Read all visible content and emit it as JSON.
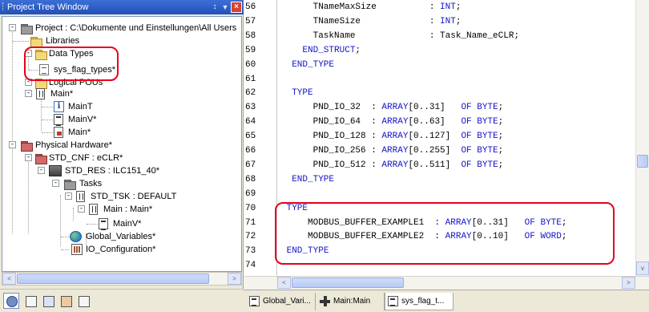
{
  "tree_window": {
    "title": "Project Tree Window",
    "pin_symbol": "↕",
    "menu_symbol": "▼",
    "close_symbol": "×",
    "nodes": {
      "project": "Project : C:\\Dokumente und Einstellungen\\All Users",
      "libraries": "Libraries",
      "data_types": "Data Types",
      "sys_flag_types": "sys_flag_types*",
      "logical_pous": "Logical POUs",
      "main": "Main*",
      "main_t": "MainT",
      "main_v": "MainV*",
      "main_code": "Main*",
      "physical_hardware": "Physical Hardware*",
      "std_cnf": "STD_CNF : eCLR*",
      "std_res": "STD_RES : ILC151_40*",
      "tasks": "Tasks",
      "std_tsk": "STD_TSK : DEFAULT",
      "main_main": "Main : Main*",
      "main_v2": "MainV*",
      "global_variables": "Global_Variables*",
      "io_configuration": "IO_Configuration*"
    },
    "icons": [
      "project-folder-icon",
      "folder-icon",
      "data-type-icon",
      "info-icon",
      "list-icon",
      "program-icon",
      "hardware-icon",
      "globe-icon",
      "io-config-icon"
    ],
    "toolbar_buttons": [
      "project-tree-tab",
      "edit-wizard-tab",
      "library-tab",
      "variables-tab",
      "io-tab"
    ]
  },
  "editor": {
    "line_numbers": [
      "56",
      "57",
      "58",
      "59",
      "60",
      "61",
      "62",
      "63",
      "64",
      "65",
      "66",
      "67",
      "68",
      "69",
      "70",
      "71",
      "72",
      "73",
      "74"
    ],
    "lines": [
      {
        "n": "56",
        "k": "",
        "c": "      TNameMaxSize          : INT;"
      },
      {
        "n": "57",
        "k": "",
        "c": "      TNameSize             : INT;"
      },
      {
        "n": "58",
        "k": "",
        "c": "      TaskName              : Task_Name_eCLR;"
      },
      {
        "n": "59",
        "k": "",
        "c": "    END_STRUCT;"
      },
      {
        "n": "60",
        "k": "",
        "c": "  END_TYPE"
      },
      {
        "n": "61",
        "k": "",
        "c": ""
      },
      {
        "n": "62",
        "k": "",
        "c": "  TYPE"
      },
      {
        "n": "63",
        "k": "",
        "c": "      PND_IO_32  : ARRAY[0..31]   OF BYTE;"
      },
      {
        "n": "64",
        "k": "",
        "c": "      PND_IO_64  : ARRAY[0..63]   OF BYTE;"
      },
      {
        "n": "65",
        "k": "",
        "c": "      PND_IO_128 : ARRAY[0..127]  OF BYTE;"
      },
      {
        "n": "66",
        "k": "",
        "c": "      PND_IO_256 : ARRAY[0..255]  OF BYTE;"
      },
      {
        "n": "67",
        "k": "",
        "c": "      PND_IO_512 : ARRAY[0..511]  OF BYTE;"
      },
      {
        "n": "68",
        "k": "",
        "c": "  END_TYPE"
      },
      {
        "n": "69",
        "k": "",
        "c": ""
      },
      {
        "n": "70",
        "k": "",
        "c": " TYPE"
      },
      {
        "n": "71",
        "k": "",
        "c": "     MODBUS_BUFFER_EXAMPLE1  : ARRAY[0..31]   OF BYTE;"
      },
      {
        "n": "72",
        "k": "",
        "c": "     MODBUS_BUFFER_EXAMPLE2  : ARRAY[0..10]   OF WORD;"
      },
      {
        "n": "73",
        "k": "",
        "c": " END_TYPE"
      },
      {
        "n": "74",
        "k": "",
        "c": ""
      }
    ],
    "keyword_color": "#1414c8"
  },
  "tabs": [
    {
      "label": "Global_Vari...",
      "icon": "list-icon"
    },
    {
      "label": "Main:Main",
      "icon": "pou-icon"
    },
    {
      "label": "sys_flag_t...",
      "icon": "list-icon"
    }
  ],
  "scroll_arrows": {
    "left": "<",
    "right": ">",
    "down": "v"
  },
  "colors": {
    "titlebar": "#2350b8",
    "highlight": "#e8001c",
    "keyword": "#1414c8"
  }
}
